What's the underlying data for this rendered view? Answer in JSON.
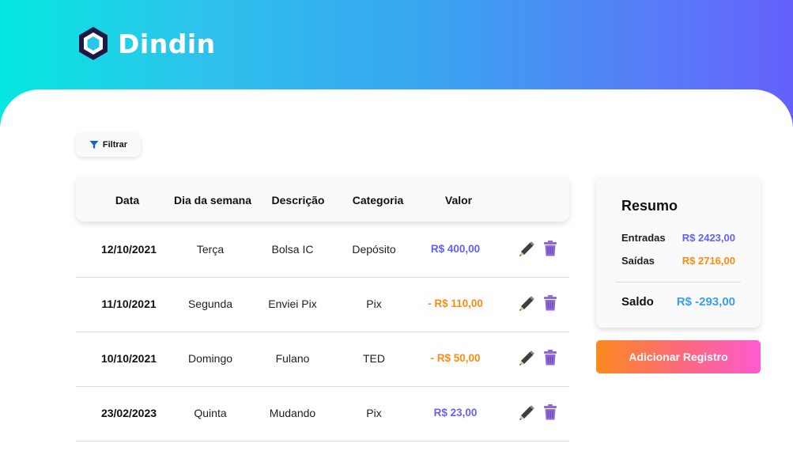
{
  "app": {
    "name": "Dindin"
  },
  "toolbar": {
    "filter_label": "Filtrar"
  },
  "table": {
    "headers": {
      "date": "Data",
      "weekday": "Dia da semana",
      "description": "Descrição",
      "category": "Categoria",
      "value": "Valor"
    },
    "rows": [
      {
        "date": "12/10/2021",
        "weekday": "Terça",
        "description": "Bolsa IC",
        "category": "Depósito",
        "value": "R$ 400,00",
        "type": "income"
      },
      {
        "date": "11/10/2021",
        "weekday": "Segunda",
        "description": "Enviei Pix",
        "category": "Pix",
        "value": "- R$ 110,00",
        "type": "expense"
      },
      {
        "date": "10/10/2021",
        "weekday": "Domingo",
        "description": "Fulano",
        "category": "TED",
        "value": "- R$ 50,00",
        "type": "expense"
      },
      {
        "date": "23/02/2023",
        "weekday": "Quinta",
        "description": "Mudando",
        "category": "Pix",
        "value": "R$ 23,00",
        "type": "income"
      }
    ],
    "row_icons": [
      "pencil-icon",
      "trash-icon"
    ]
  },
  "summary": {
    "title": "Resumo",
    "income_label": "Entradas",
    "income_value": "R$ 2423,00",
    "expense_label": "Saídas",
    "expense_value": "R$ 2716,00",
    "balance_label": "Saldo",
    "balance_value": "R$ -293,00"
  },
  "actions": {
    "add_record_label": "Adicionar Registro"
  },
  "colors": {
    "income": "#645ffb",
    "expense": "#fa8c10",
    "balance": "#3a9ff1",
    "trash": "#8f6ad8",
    "pencil": "#3f3f3f",
    "logo_dark": "#1c1a45"
  }
}
